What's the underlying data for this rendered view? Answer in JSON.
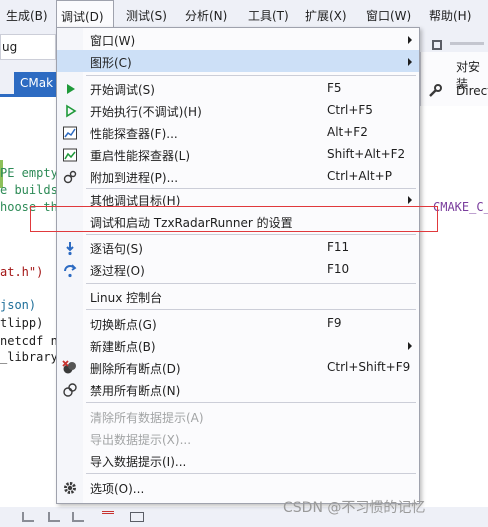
{
  "menubar": {
    "items": [
      {
        "label": "生成(B)"
      },
      {
        "label": "调试(D)"
      },
      {
        "label": "测试(S)"
      },
      {
        "label": "分析(N)"
      },
      {
        "label": "工具(T)"
      },
      {
        "label": "扩展(X)"
      },
      {
        "label": "窗口(W)"
      },
      {
        "label": "帮助(H)"
      }
    ]
  },
  "toolbar": {
    "config_value": "ug"
  },
  "tabs": {
    "active_label": "CMak"
  },
  "editor": {
    "lines": [
      "PE empty.",
      "e builds.",
      "hoose the",
      "at.h\")",
      "json)",
      "tlipp)",
      "netcdf n",
      "_library)"
    ],
    "right_text": "CMAKE_C_"
  },
  "submenu": {
    "items": [
      {
        "label": "对安装"
      },
      {
        "label": "Direct"
      }
    ]
  },
  "menu": {
    "items": [
      {
        "label": "窗口(W)",
        "shortcut": "",
        "submenu": true
      },
      {
        "label": "图形(C)",
        "shortcut": "",
        "submenu": true
      },
      {
        "label": "开始调试(S)",
        "shortcut": "F5",
        "icon": "play-green-icon"
      },
      {
        "label": "开始执行(不调试)(H)",
        "shortcut": "Ctrl+F5",
        "icon": "play-outline-icon"
      },
      {
        "label": "性能探查器(F)...",
        "shortcut": "Alt+F2",
        "icon": "performance-profiler-icon"
      },
      {
        "label": "重启性能探查器(L)",
        "shortcut": "Shift+Alt+F2",
        "icon": "relaunch-profiler-icon"
      },
      {
        "label": "附加到进程(P)...",
        "shortcut": "Ctrl+Alt+P",
        "icon": "attach-process-icon"
      },
      {
        "label": "其他调试目标(H)",
        "shortcut": "",
        "submenu": true
      },
      {
        "label": "调试和启动 TzxRadarRunner 的设置",
        "shortcut": ""
      },
      {
        "label": "逐语句(S)",
        "shortcut": "F11",
        "icon": "step-into-icon"
      },
      {
        "label": "逐过程(O)",
        "shortcut": "F10",
        "icon": "step-over-icon"
      },
      {
        "label": "Linux 控制台",
        "shortcut": ""
      },
      {
        "label": "切换断点(G)",
        "shortcut": "F9"
      },
      {
        "label": "新建断点(B)",
        "shortcut": "",
        "submenu": true
      },
      {
        "label": "删除所有断点(D)",
        "shortcut": "Ctrl+Shift+F9",
        "icon": "delete-breakpoints-icon"
      },
      {
        "label": "禁用所有断点(N)",
        "shortcut": "",
        "icon": "disable-breakpoints-icon"
      },
      {
        "label": "清除所有数据提示(A)",
        "shortcut": "",
        "disabled": true
      },
      {
        "label": "导出数据提示(X)...",
        "shortcut": "",
        "disabled": true
      },
      {
        "label": "导入数据提示(I)...",
        "shortcut": ""
      },
      {
        "label": "选项(O)...",
        "shortcut": "",
        "icon": "gear-icon"
      }
    ]
  },
  "watermark": {
    "text": "CSDN @不习惯的记忆"
  },
  "colors": {
    "accent": "#2d6bc2",
    "highlight": "#cde0f7",
    "annotation_red": "#e0393c",
    "play_green": "#1f9a3a"
  }
}
